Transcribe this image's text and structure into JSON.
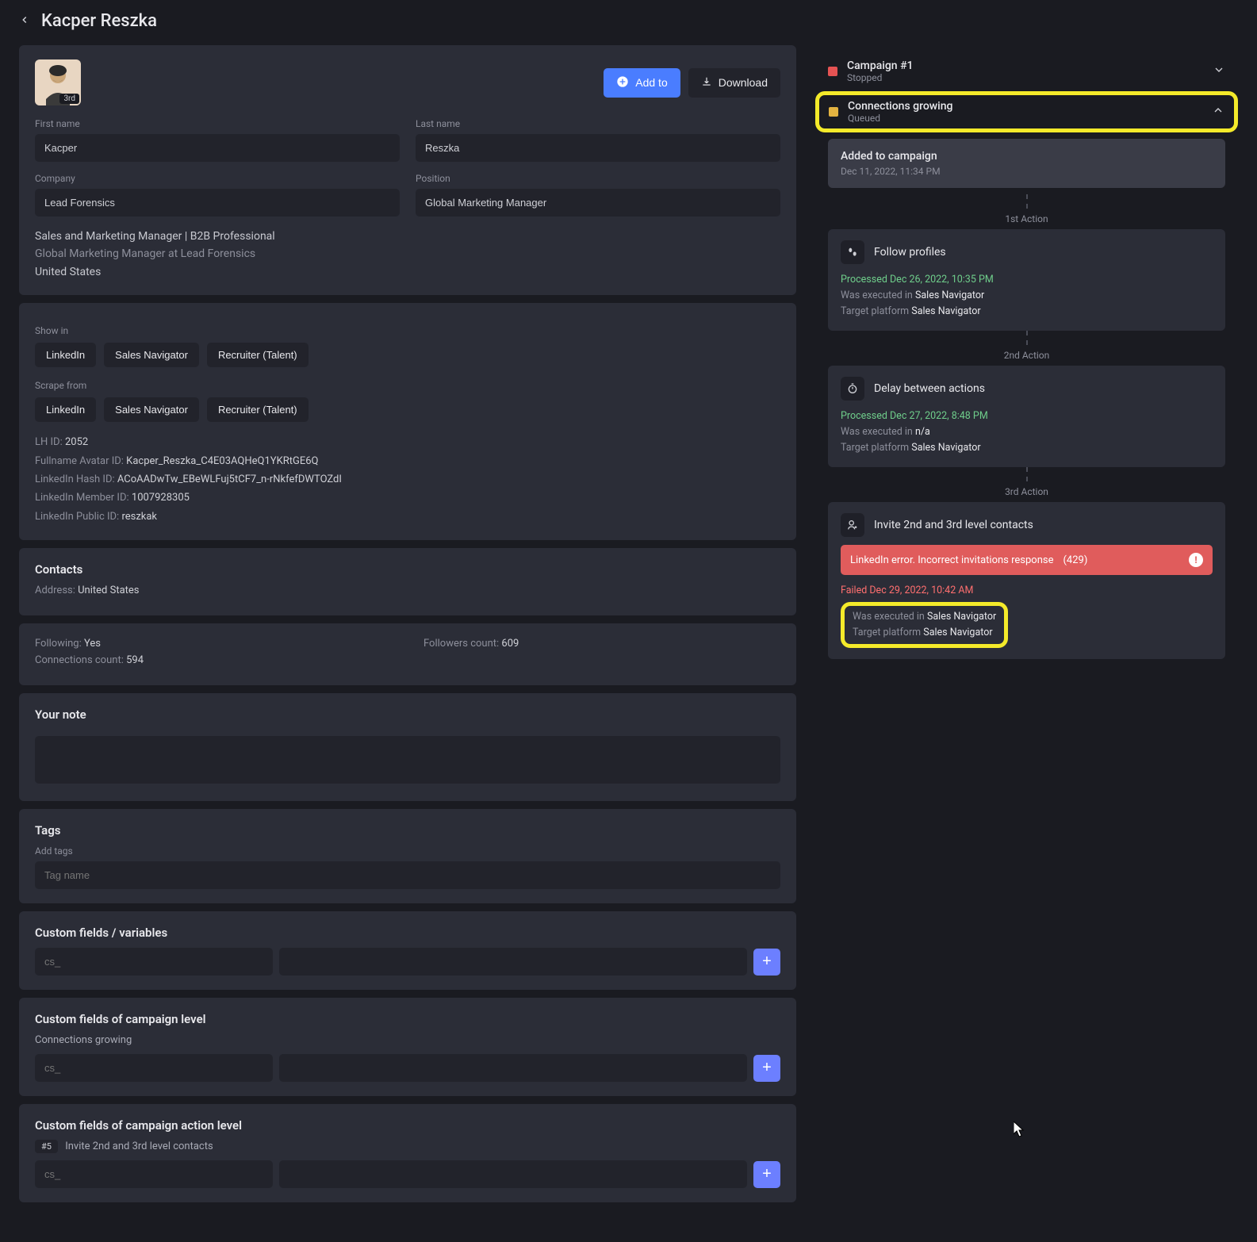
{
  "header": {
    "title": "Kacper Reszka"
  },
  "profile": {
    "avatar_badge": "3rd",
    "buttons": {
      "add_to": "Add to",
      "download": "Download"
    },
    "first_name_label": "First name",
    "first_name": "Kacper",
    "last_name_label": "Last name",
    "last_name": "Reszka",
    "company_label": "Company",
    "company": "Lead Forensics",
    "position_label": "Position",
    "position": "Global Marketing Manager",
    "bio_line1": "Sales and Marketing Manager | B2B Professional",
    "bio_line2": "Global Marketing Manager at Lead Forensics",
    "location": "United States"
  },
  "show_in": {
    "label": "Show in",
    "linkedin": "LinkedIn",
    "sales_nav": "Sales Navigator",
    "recruiter": "Recruiter (Talent)"
  },
  "scrape_from": {
    "label": "Scrape from",
    "linkedin": "LinkedIn",
    "sales_nav": "Sales Navigator",
    "recruiter": "Recruiter (Talent)"
  },
  "ids": {
    "lh_id_k": "LH ID:",
    "lh_id_v": "2052",
    "avatar_id_k": "Fullname Avatar ID:",
    "avatar_id_v": "Kacper_Reszka_C4E03AQHeQ1YKRtGE6Q",
    "hash_id_k": "LinkedIn Hash ID:",
    "hash_id_v": "ACoAADwTw_EBeWLFuj5tCF7_n-rNkfefDWTOZdI",
    "member_id_k": "LinkedIn Member ID:",
    "member_id_v": "1007928305",
    "public_id_k": "LinkedIn Public ID:",
    "public_id_v": "reszkak"
  },
  "contacts": {
    "title": "Contacts",
    "address_k": "Address:",
    "address_v": "United States",
    "following_k": "Following:",
    "following_v": "Yes",
    "followers_k": "Followers count:",
    "followers_v": "609",
    "connections_k": "Connections count:",
    "connections_v": "594"
  },
  "note": {
    "title": "Your note",
    "value": ""
  },
  "tags": {
    "title": "Tags",
    "add_label": "Add tags",
    "placeholder": "Tag name"
  },
  "custom_fields": {
    "title": "Custom fields / variables",
    "key_placeholder": "cs_"
  },
  "custom_fields_campaign": {
    "title": "Custom fields of campaign level",
    "campaign_name": "Connections growing",
    "key_placeholder": "cs_"
  },
  "custom_fields_action": {
    "title": "Custom fields of campaign action level",
    "badge": "#5",
    "action_name": "Invite 2nd and 3rd level contacts",
    "key_placeholder": "cs_"
  },
  "campaigns": {
    "c1": {
      "title": "Campaign #1",
      "status": "Stopped"
    },
    "c2": {
      "title": "Connections growing",
      "status": "Queued"
    }
  },
  "timeline": {
    "added": {
      "title": "Added to campaign",
      "ts": "Dec 11, 2022, 11:34 PM"
    },
    "a1_label": "1st Action",
    "a1": {
      "title": "Follow profiles",
      "processed": "Processed Dec 26, 2022, 10:35 PM",
      "exec_k": "Was executed in",
      "exec_v": "Sales Navigator",
      "tgt_k": "Target platform",
      "tgt_v": "Sales Navigator"
    },
    "a2_label": "2nd Action",
    "a2": {
      "title": "Delay between actions",
      "processed": "Processed Dec 27, 2022, 8:48 PM",
      "exec_k": "Was executed in",
      "exec_v": "n/a",
      "tgt_k": "Target platform",
      "tgt_v": "Sales Navigator"
    },
    "a3_label": "3rd Action",
    "a3": {
      "title": "Invite 2nd and 3rd level contacts",
      "error_msg": "LinkedIn error. Incorrect invitations response",
      "error_code": "(429)",
      "failed": "Failed Dec 29, 2022, 10:42 AM",
      "exec_k": "Was executed in",
      "exec_v": "Sales Navigator",
      "tgt_k": "Target platform",
      "tgt_v": "Sales Navigator"
    }
  }
}
